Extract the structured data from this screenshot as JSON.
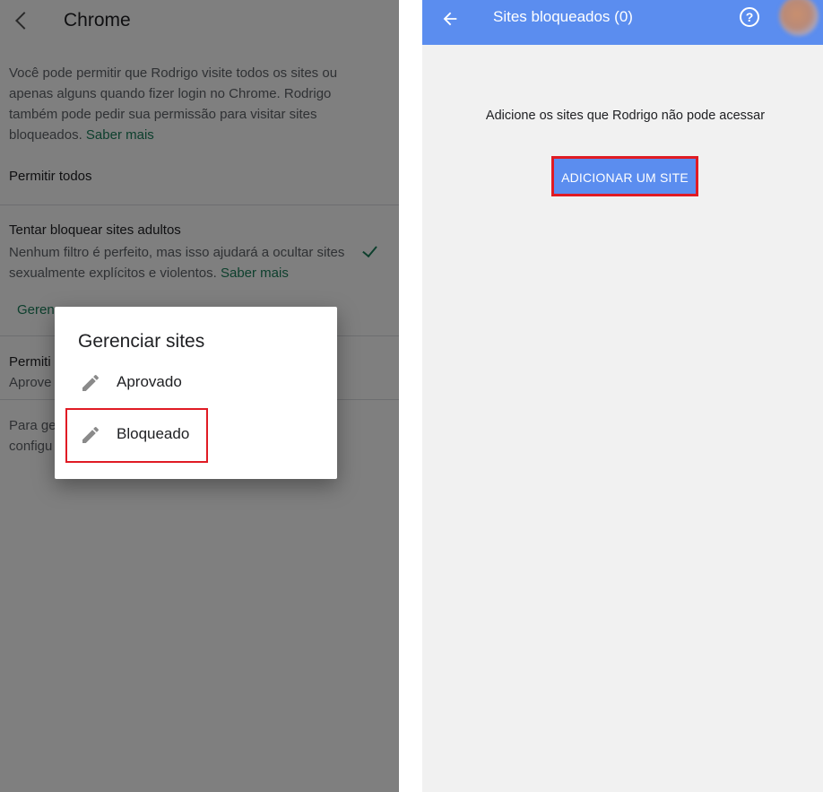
{
  "left_panel": {
    "header": {
      "title": "Chrome",
      "back_icon": "chevron-left-icon"
    },
    "description": "Você pode permitir que Rodrigo visite todos os sites ou apenas alguns quando fizer login no Chrome. Rodrigo também pode pedir sua permissão para visitar sites bloqueados.",
    "description_link": "Saber mais",
    "allow_all": "Permitir todos",
    "block_adult": {
      "title": "Tentar bloquear sites adultos",
      "subtitle": "Nenhum filtro é perfeito, mas isso ajudará a ocultar sites sexualmente explícitos e violentos.",
      "link": "Saber mais",
      "check_icon": "check-icon"
    },
    "manage_button": "Geren",
    "permission_row": {
      "title": "Permiti",
      "subtitle": "Aprove"
    },
    "config_row": {
      "line1": "Para ge",
      "line2": "configu"
    },
    "dialog": {
      "title": "Gerenciar sites",
      "items": [
        {
          "label": "Aprovado",
          "icon": "pencil-icon"
        },
        {
          "label": "Bloqueado",
          "icon": "pencil-icon"
        }
      ],
      "highlight_color": "#e01b24"
    }
  },
  "right_panel": {
    "toolbar": {
      "title": "Sites bloqueados (0)",
      "back_icon": "arrow-left-icon",
      "help_icon": "help-circle-icon",
      "help_glyph": "?",
      "color": "#5b8def"
    },
    "message": "Adicione os sites que Rodrigo não pode acessar",
    "add_button": "ADICIONAR UM SITE"
  }
}
